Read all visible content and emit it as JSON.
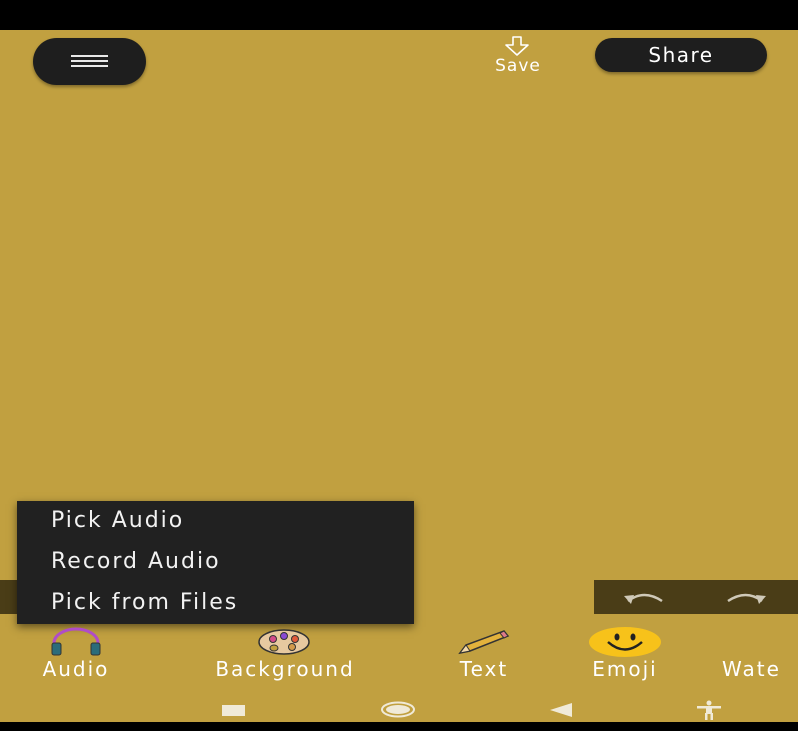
{
  "header": {
    "menu_icon": "hamburger-icon",
    "save_label": "Save",
    "save_icon": "download-arrow-icon",
    "share_label": "Share"
  },
  "canvas": {
    "background_color": "#c1a040"
  },
  "audio_menu": {
    "items": [
      {
        "label": "Pick Audio"
      },
      {
        "label": "Record Audio"
      },
      {
        "label": "Pick from Files"
      }
    ]
  },
  "undo_redo": {
    "undo_icon": "undo-icon",
    "redo_icon": "redo-icon"
  },
  "toolbar": {
    "items": [
      {
        "label": "Audio",
        "icon": "headphones-icon"
      },
      {
        "label": "Background",
        "icon": "palette-icon"
      },
      {
        "label": "Text",
        "icon": "pencil-icon"
      },
      {
        "label": "Emoji",
        "icon": "smiley-icon"
      },
      {
        "label": "Wate",
        "icon": ""
      }
    ]
  },
  "nav_bar": {
    "icons": [
      "recents-icon",
      "home-icon",
      "back-icon",
      "accessibility-icon"
    ]
  }
}
